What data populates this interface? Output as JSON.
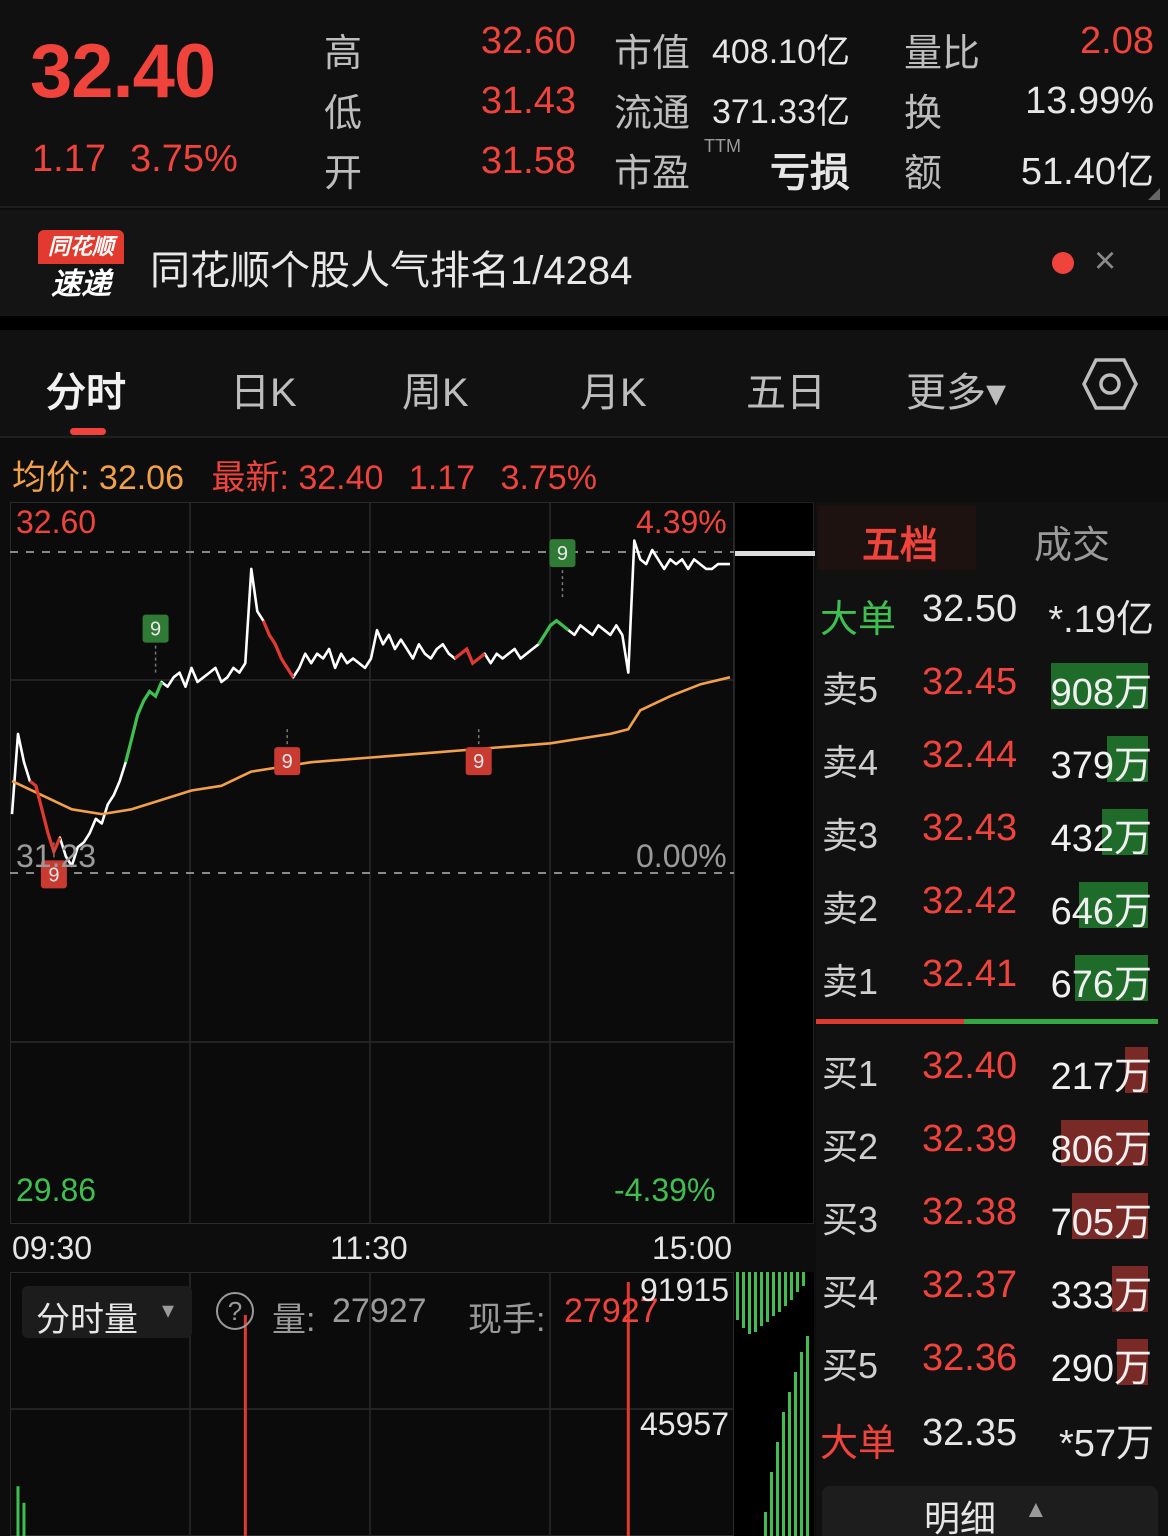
{
  "quote": {
    "price": "32.40",
    "change": "1.17",
    "change_pct": "3.75%",
    "high_label": "高",
    "high": "32.60",
    "low_label": "低",
    "low": "31.43",
    "open_label": "开",
    "open": "31.58",
    "mktcap_label": "市值",
    "mktcap": "408.10亿",
    "float_label": "流通",
    "float": "371.33亿",
    "pe_label": "市盈",
    "pe_sup": "TTM",
    "pe": "亏损",
    "volratio_label": "量比",
    "volratio": "2.08",
    "turnover_label": "换",
    "turnover": "13.99%",
    "amount_label": "额",
    "amount": "51.40亿"
  },
  "news": {
    "logo_top": "同花顺",
    "logo_bottom": "速递",
    "text": "同花顺个股人气排名1/4284",
    "close_icon": "×"
  },
  "tabs": [
    {
      "label": "分时"
    },
    {
      "label": "日K"
    },
    {
      "label": "周K"
    },
    {
      "label": "月K"
    },
    {
      "label": "五日"
    },
    {
      "label": "更多▾"
    }
  ],
  "info": {
    "avg_label": "均价:",
    "avg": "32.06",
    "latest_label": "最新:",
    "latest": "32.40",
    "latest_change": "1.17",
    "latest_pct": "3.75%"
  },
  "chart_data": {
    "type": "line",
    "title": "",
    "xlabel": "",
    "ylabel": "",
    "x_ticks": [
      "09:30",
      "11:30",
      "15:00"
    ],
    "y_labels_left": [
      "32.60",
      "31.23",
      "29.86"
    ],
    "y_labels_right": [
      "4.39%",
      "0.00%",
      "-4.39%"
    ],
    "ylim": [
      29.86,
      32.6
    ],
    "prev_close": 31.23,
    "series": [
      {
        "name": "",
        "color": "#ffffff",
        "x": [
          0,
          2,
          4,
          6,
          8,
          10,
          12,
          14,
          16,
          18,
          20,
          22,
          24,
          26,
          28,
          30,
          32,
          34,
          36,
          38,
          40,
          42,
          44,
          46,
          48,
          50,
          52,
          54,
          56,
          58,
          60,
          62,
          64,
          66,
          68,
          70,
          72,
          74,
          76,
          78,
          80,
          82,
          84,
          86,
          88,
          90,
          92,
          94,
          96,
          98,
          100,
          102,
          104,
          106,
          108,
          110,
          112,
          114,
          116,
          118,
          120,
          122,
          124,
          126,
          128,
          130,
          132,
          134,
          136,
          138,
          140,
          142,
          144,
          146,
          148,
          150,
          152,
          154,
          156,
          158,
          160,
          162,
          164,
          166,
          168,
          170,
          172,
          174,
          176,
          178,
          180,
          182,
          184,
          186,
          188,
          190,
          192,
          194,
          196,
          198,
          200,
          202,
          204,
          206,
          208,
          210,
          212,
          214,
          216,
          218,
          220,
          222,
          224,
          226,
          228,
          230,
          232,
          234,
          236,
          238,
          240
        ],
        "values": [
          31.48,
          31.82,
          31.7,
          31.62,
          31.6,
          31.5,
          31.4,
          31.32,
          31.38,
          31.3,
          31.26,
          31.34,
          31.36,
          31.4,
          31.46,
          31.44,
          31.52,
          31.56,
          31.62,
          31.7,
          31.8,
          31.9,
          31.96,
          32.0,
          31.98,
          32.04,
          32.02,
          32.06,
          32.08,
          32.02,
          32.1,
          32.04,
          32.06,
          32.08,
          32.1,
          32.04,
          32.06,
          32.1,
          32.08,
          32.12,
          32.52,
          32.34,
          32.3,
          32.24,
          32.2,
          32.14,
          32.1,
          32.06,
          32.1,
          32.16,
          32.12,
          32.16,
          32.14,
          32.18,
          32.1,
          32.16,
          32.12,
          32.14,
          32.12,
          32.1,
          32.14,
          32.26,
          32.2,
          32.24,
          32.18,
          32.22,
          32.18,
          32.14,
          32.2,
          32.16,
          32.14,
          32.18,
          32.2,
          32.16,
          32.14,
          32.16,
          32.18,
          32.12,
          32.14,
          32.16,
          32.12,
          32.16,
          32.14,
          32.16,
          32.18,
          32.14,
          32.16,
          32.18,
          32.2,
          32.24,
          32.28,
          32.3,
          32.28,
          32.26,
          32.24,
          32.28,
          32.26,
          32.24,
          32.28,
          32.26,
          32.24,
          32.28,
          32.24,
          32.08,
          32.64,
          32.56,
          32.54,
          32.6,
          32.56,
          32.52,
          32.56,
          32.54,
          32.56,
          32.52,
          32.56,
          32.54,
          32.52,
          32.52,
          32.54,
          32.54,
          32.54
        ]
      },
      {
        "name": "",
        "color": "#f2a14a",
        "x": [
          0,
          10,
          20,
          30,
          40,
          50,
          60,
          70,
          80,
          90,
          100,
          120,
          140,
          160,
          180,
          200,
          206,
          210,
          220,
          230,
          240
        ],
        "values": [
          31.62,
          31.56,
          31.5,
          31.48,
          31.5,
          31.54,
          31.58,
          31.6,
          31.66,
          31.68,
          31.7,
          31.72,
          31.74,
          31.76,
          31.78,
          31.82,
          31.84,
          31.92,
          31.98,
          32.03,
          32.06
        ]
      }
    ],
    "markers": [
      {
        "x": 14,
        "value": 31.36,
        "label": "9",
        "color": "#c93a31"
      },
      {
        "x": 48,
        "value": 32.08,
        "label": "9",
        "color": "#2f7a35"
      },
      {
        "x": 92,
        "value": 31.84,
        "label": "9",
        "color": "#c93a31"
      },
      {
        "x": 156,
        "value": 31.84,
        "label": "9",
        "color": "#c93a31"
      },
      {
        "x": 184,
        "value": 32.4,
        "label": "9",
        "color": "#2f7a35"
      }
    ]
  },
  "volume": {
    "selector": "分时量",
    "selector_arrow": "▾",
    "help_icon": "?",
    "vol_label": "量:",
    "vol": "27927",
    "hand_label": "现手:",
    "hand": "27927",
    "ticks": [
      "91915",
      "45957"
    ],
    "bars": [
      {
        "x": 2,
        "value": 18000,
        "color": "#3fbf50"
      },
      {
        "x": 4,
        "value": 12000,
        "color": "#3fbf50"
      },
      {
        "x": 78,
        "value": 80000,
        "color": "#e0392f"
      },
      {
        "x": 206,
        "value": 91915,
        "color": "#e0392f"
      }
    ]
  },
  "orderbook": {
    "tab_five": "五档",
    "tab_trades": "成交",
    "big_sell": {
      "label": "大单",
      "price": "32.50",
      "vol": "*.19亿"
    },
    "asks": [
      {
        "label": "卖5",
        "price": "32.45",
        "vol": "908万",
        "bar": 0.88
      },
      {
        "label": "卖4",
        "price": "32.44",
        "vol": "379万",
        "bar": 0.37
      },
      {
        "label": "卖3",
        "price": "32.43",
        "vol": "432万",
        "bar": 0.42
      },
      {
        "label": "卖2",
        "price": "32.42",
        "vol": "646万",
        "bar": 0.63
      },
      {
        "label": "卖1",
        "price": "32.41",
        "vol": "676万",
        "bar": 0.66
      }
    ],
    "bids": [
      {
        "label": "买1",
        "price": "32.40",
        "vol": "217万",
        "bar": 0.21
      },
      {
        "label": "买2",
        "price": "32.39",
        "vol": "806万",
        "bar": 0.79
      },
      {
        "label": "买3",
        "price": "32.38",
        "vol": "705万",
        "bar": 0.69
      },
      {
        "label": "买4",
        "price": "32.37",
        "vol": "333万",
        "bar": 0.33
      },
      {
        "label": "买5",
        "price": "32.36",
        "vol": "290万",
        "bar": 0.28
      }
    ],
    "big_buy": {
      "label": "大单",
      "price": "32.35",
      "vol": "*57万"
    },
    "detail": "明细",
    "detail_arrow": "▲"
  }
}
